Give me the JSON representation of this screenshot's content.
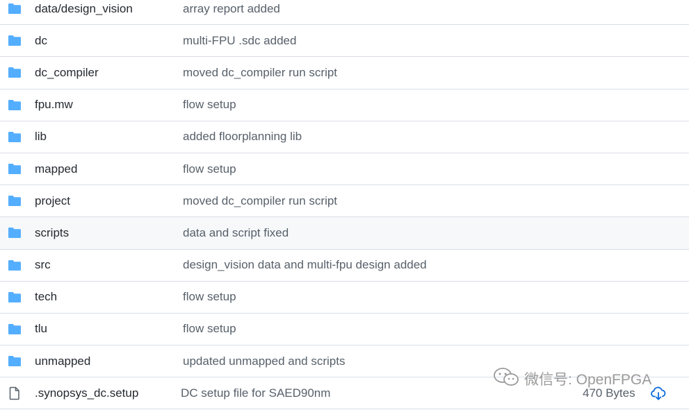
{
  "rows": [
    {
      "name": "data/design_vision",
      "message": "array report added",
      "type": "folder"
    },
    {
      "name": "dc",
      "message": "multi-FPU .sdc added",
      "type": "folder"
    },
    {
      "name": "dc_compiler",
      "message": "moved dc_compiler run script",
      "type": "folder"
    },
    {
      "name": "fpu.mw",
      "message": "flow setup",
      "type": "folder"
    },
    {
      "name": "lib",
      "message": "added floorplanning lib",
      "type": "folder"
    },
    {
      "name": "mapped",
      "message": "flow setup",
      "type": "folder"
    },
    {
      "name": "project",
      "message": "moved dc_compiler run script",
      "type": "folder"
    },
    {
      "name": "scripts",
      "message": "data and script fixed",
      "type": "folder"
    },
    {
      "name": "src",
      "message": "design_vision data and multi-fpu design added",
      "type": "folder"
    },
    {
      "name": "tech",
      "message": "flow setup",
      "type": "folder"
    },
    {
      "name": "tlu",
      "message": "flow setup",
      "type": "folder"
    },
    {
      "name": "unmapped",
      "message": "updated unmapped and scripts",
      "type": "folder"
    },
    {
      "name": ".synopsys_dc.setup",
      "message": "DC setup file for SAED90nm",
      "type": "file",
      "size": "470 Bytes"
    }
  ],
  "watermark": {
    "text": "微信号: OpenFPGA"
  },
  "colors": {
    "folder": "#54aeff",
    "file": "#57606a",
    "download": "#0969da",
    "highlight_row": "#f6f8fa"
  },
  "icons": {
    "folder": "folder-icon",
    "file": "file-icon",
    "download": "cloud-download-icon",
    "wechat": "wechat-icon"
  }
}
